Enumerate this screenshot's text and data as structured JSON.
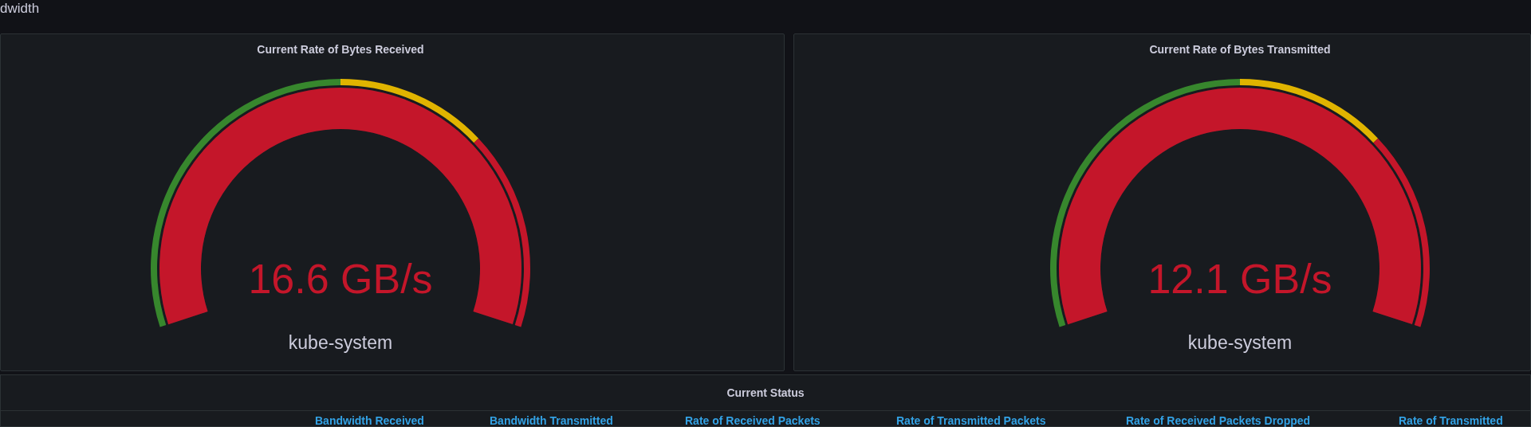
{
  "row_title": "dwidth",
  "gauges": [
    {
      "title": "Current Rate of Bytes Received",
      "value": "16.6 GB/s",
      "label": "kube-system",
      "level": 1
    },
    {
      "title": "Current Rate of Bytes Transmitted",
      "value": "12.1 GB/s",
      "label": "kube-system",
      "level": 1
    }
  ],
  "status_panel": {
    "title": "Current Status",
    "columns": [
      "Bandwidth Received",
      "Bandwidth Transmitted",
      "Rate of Received Packets",
      "Rate of Transmitted Packets",
      "Rate of Received Packets Dropped",
      "Rate of Transmitted"
    ]
  }
}
